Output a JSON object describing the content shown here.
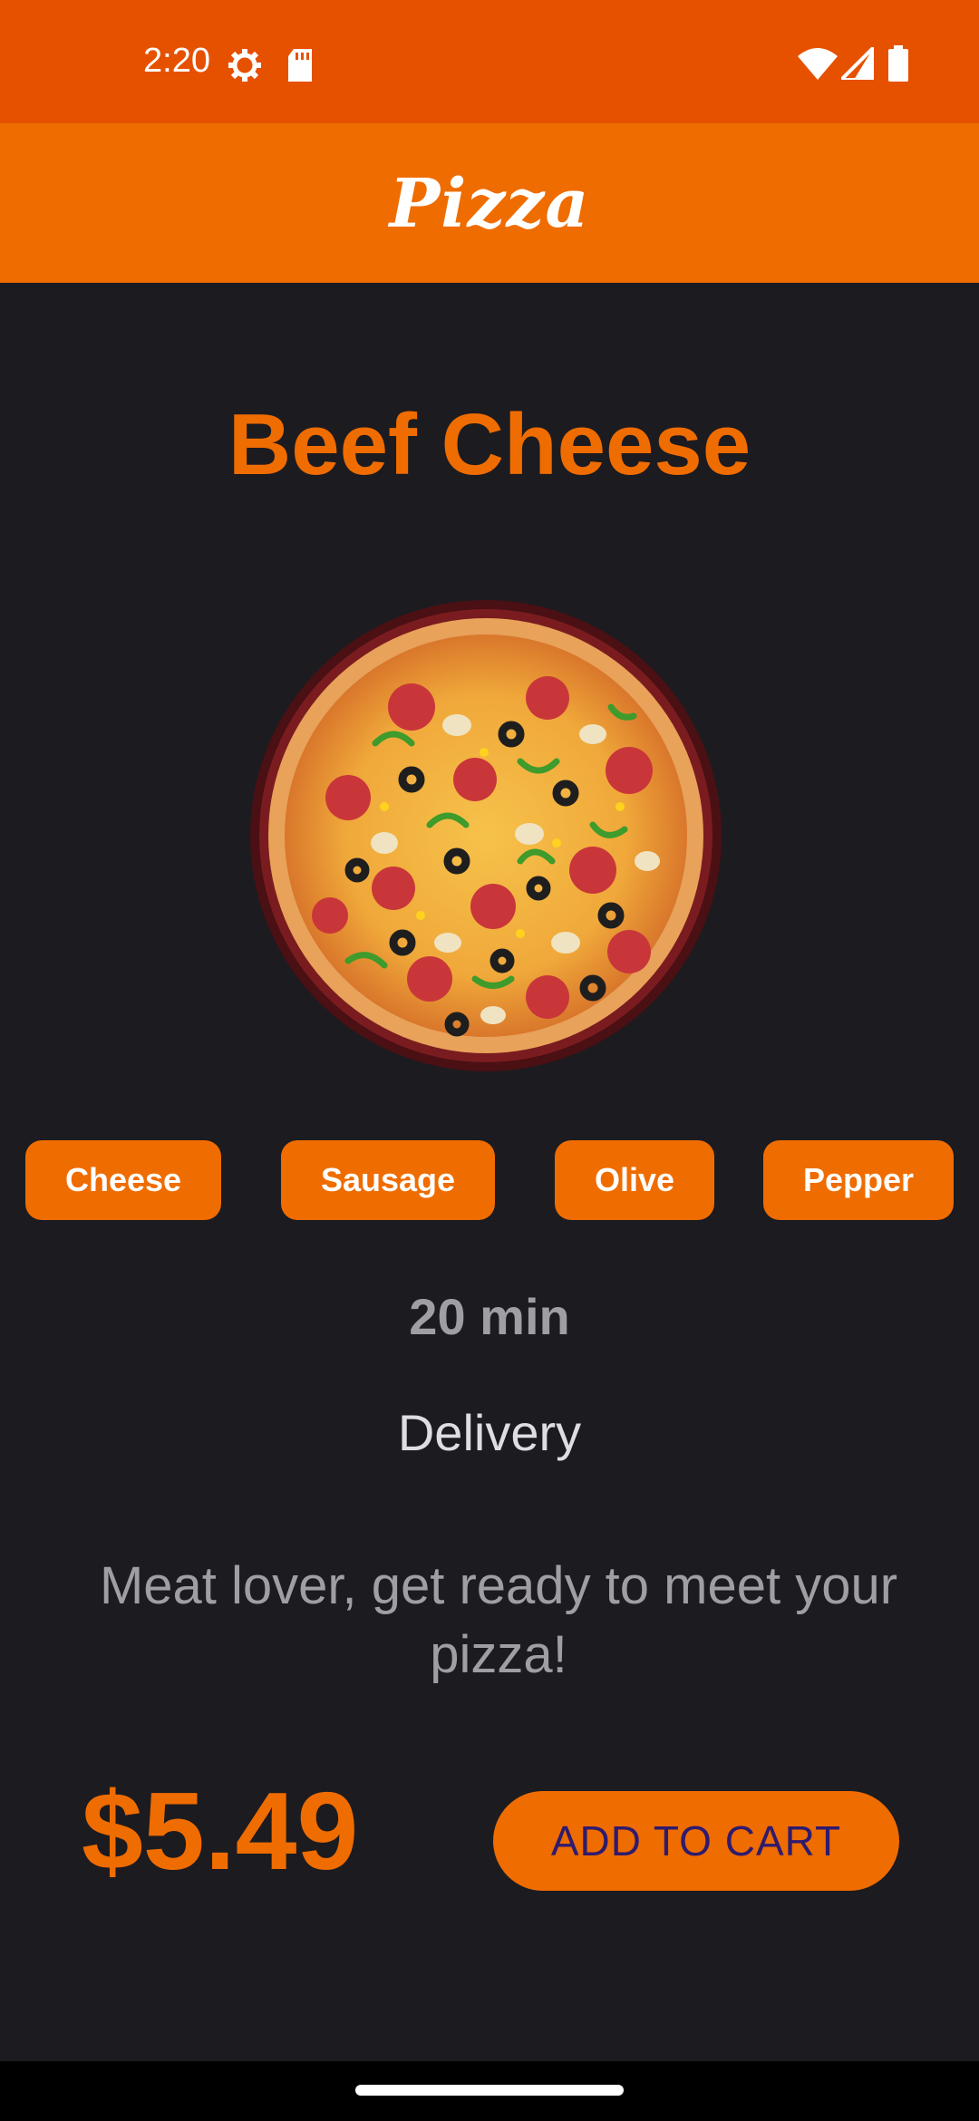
{
  "status_bar": {
    "time": "2:20",
    "icons": [
      "settings-gear-icon",
      "sd-card-icon",
      "wifi-icon",
      "signal-icon",
      "battery-icon"
    ]
  },
  "app_bar": {
    "title": "Pizza"
  },
  "product": {
    "name": "Beef Cheese",
    "image_icon": "pizza-image",
    "toppings": [
      "Cheese",
      "Sausage",
      "Olive",
      "Pepper"
    ],
    "time": "20 min",
    "delivery_label": "Delivery",
    "description": "Meat lover, get ready to meet your pizza!",
    "price": "$5.49",
    "add_to_cart_label": "ADD TO CART"
  },
  "colors": {
    "status_bar": "#e65100",
    "app_bar": "#ef6c00",
    "accent": "#ef6c00",
    "background": "#1c1b20",
    "button_text": "#2f1b6e"
  }
}
